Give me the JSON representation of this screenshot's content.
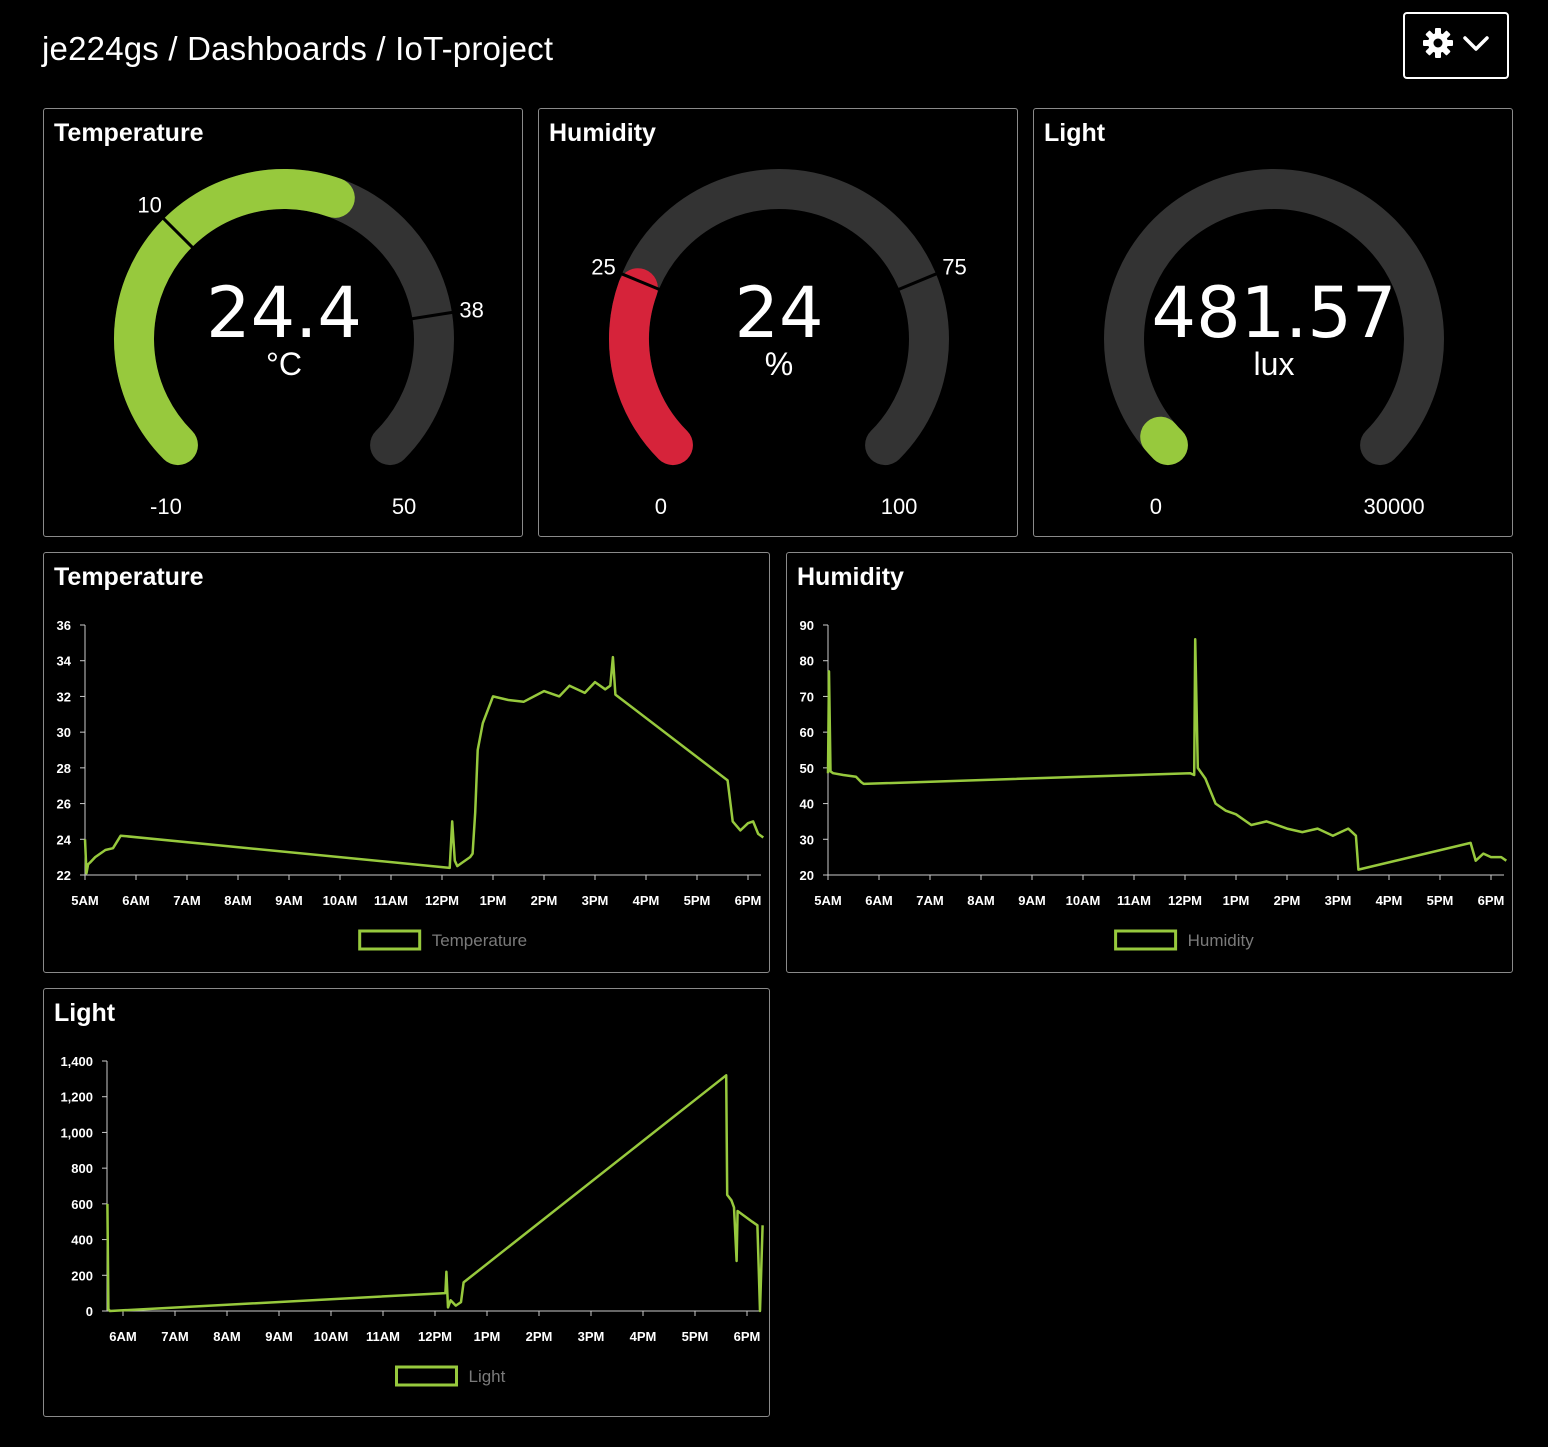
{
  "header": {
    "breadcrumb": "je224gs / Dashboards / IoT-project",
    "settings_icon": "gear-icon",
    "dropdown_icon": "chevron-down-icon"
  },
  "colors": {
    "background": "#000000",
    "accent_green": "#97c93d",
    "alert_red": "#d6233a",
    "track_gray": "#333333",
    "panel_border": "#8a8a8a"
  },
  "gauges": [
    {
      "title": "Temperature",
      "value": "24.4",
      "unit": "°C",
      "min": -10,
      "max": 50,
      "low_threshold": "10",
      "high_threshold": "38",
      "min_label": "-10",
      "max_label": "50",
      "value_num": 24.4,
      "color": "#97c93d"
    },
    {
      "title": "Humidity",
      "value": "24",
      "unit": "%",
      "min": 0,
      "max": 100,
      "low_threshold": "25",
      "high_threshold": "75",
      "min_label": "0",
      "max_label": "100",
      "value_num": 24,
      "color": "#d6233a"
    },
    {
      "title": "Light",
      "value": "481.57",
      "unit": "lux",
      "min": 0,
      "max": 30000,
      "min_label": "0",
      "max_label": "30000",
      "value_num": 481.57,
      "color": "#97c93d"
    }
  ],
  "chart_data": [
    {
      "type": "line",
      "title": "Temperature",
      "x_tick_labels": [
        "5AM",
        "6AM",
        "7AM",
        "8AM",
        "9AM",
        "10AM",
        "11AM",
        "12PM",
        "1PM",
        "2PM",
        "3PM",
        "4PM",
        "5PM",
        "6PM"
      ],
      "y_tick_labels": [
        "22",
        "24",
        "26",
        "28",
        "30",
        "32",
        "34",
        "36"
      ],
      "ylim": [
        22,
        36
      ],
      "legend": "Temperature",
      "grid": false,
      "series": [
        {
          "name": "Temperature",
          "x_hours": [
            5.0,
            5.03,
            5.06,
            5.1,
            5.2,
            5.4,
            5.55,
            5.7,
            12.15,
            12.2,
            12.25,
            12.3,
            12.4,
            12.55,
            12.6,
            12.65,
            12.7,
            12.8,
            13.0,
            13.3,
            13.6,
            14.0,
            14.3,
            14.5,
            14.8,
            15.0,
            15.2,
            15.3,
            15.35,
            15.4,
            17.6,
            17.7,
            17.85,
            18.0,
            18.1,
            18.2,
            18.3
          ],
          "y": [
            24.0,
            22.1,
            22.6,
            22.7,
            23.0,
            23.4,
            23.5,
            24.2,
            22.4,
            25.0,
            22.8,
            22.5,
            22.7,
            23.0,
            23.2,
            25.5,
            29.0,
            30.5,
            32.0,
            31.8,
            31.7,
            32.3,
            32.0,
            32.6,
            32.2,
            32.8,
            32.4,
            32.6,
            34.2,
            32.1,
            27.3,
            25.0,
            24.5,
            24.9,
            25.0,
            24.3,
            24.1
          ]
        }
      ]
    },
    {
      "type": "line",
      "title": "Humidity",
      "x_tick_labels": [
        "5AM",
        "6AM",
        "7AM",
        "8AM",
        "9AM",
        "10AM",
        "11AM",
        "12PM",
        "1PM",
        "2PM",
        "3PM",
        "4PM",
        "5PM",
        "6PM"
      ],
      "y_tick_labels": [
        "20",
        "30",
        "40",
        "50",
        "60",
        "70",
        "80",
        "90"
      ],
      "ylim": [
        20,
        90
      ],
      "legend": "Humidity",
      "grid": false,
      "series": [
        {
          "name": "Humidity",
          "x_hours": [
            5.0,
            5.02,
            5.05,
            5.1,
            5.3,
            5.55,
            5.65,
            5.7,
            12.1,
            12.18,
            12.2,
            12.25,
            12.4,
            12.6,
            12.8,
            13.0,
            13.3,
            13.6,
            14.0,
            14.3,
            14.6,
            14.9,
            15.2,
            15.35,
            15.4,
            17.6,
            17.7,
            17.85,
            18.0,
            18.2,
            18.3
          ],
          "y": [
            48.5,
            77.0,
            49.0,
            48.5,
            48.0,
            47.5,
            46.0,
            45.5,
            48.5,
            48.0,
            86.0,
            50.0,
            47.0,
            40.0,
            38.0,
            37.0,
            34.0,
            35.0,
            33.0,
            32.0,
            33.0,
            31.0,
            33.0,
            31.0,
            21.5,
            29.0,
            24.0,
            26.0,
            25.0,
            25.0,
            24.0
          ]
        }
      ]
    },
    {
      "type": "line",
      "title": "Light",
      "x_tick_labels": [
        "6AM",
        "7AM",
        "8AM",
        "9AM",
        "10AM",
        "11AM",
        "12PM",
        "1PM",
        "2PM",
        "3PM",
        "4PM",
        "5PM",
        "6PM"
      ],
      "y_tick_labels": [
        "0",
        "200",
        "400",
        "600",
        "800",
        "1,000",
        "1,200",
        "1,400"
      ],
      "ylim": [
        0,
        1400
      ],
      "legend": "Light",
      "grid": false,
      "series": [
        {
          "name": "Light",
          "x_hours": [
            5.7,
            5.72,
            5.75,
            12.2,
            12.22,
            12.25,
            12.3,
            12.4,
            12.5,
            12.55,
            17.6,
            17.62,
            17.7,
            17.75,
            17.8,
            17.82,
            18.1,
            18.2,
            18.25,
            18.3
          ],
          "y": [
            600,
            10,
            0,
            100,
            220,
            20,
            60,
            30,
            50,
            160,
            1320,
            650,
            620,
            580,
            280,
            560,
            500,
            480,
            0,
            480
          ]
        }
      ]
    }
  ]
}
